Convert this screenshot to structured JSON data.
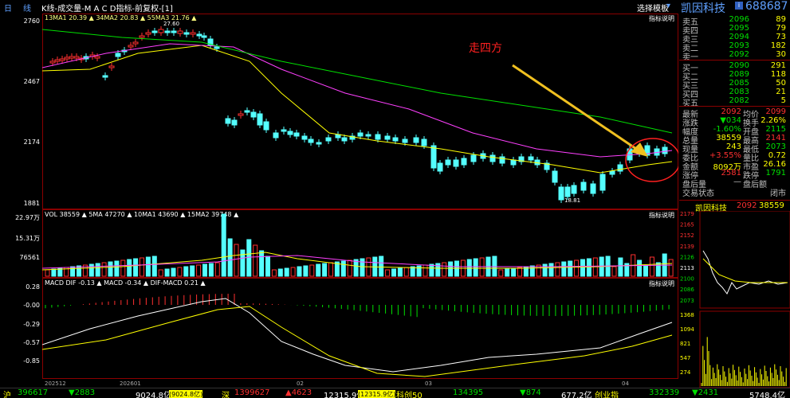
{
  "window": {
    "day_tab": "日",
    "line_tab": "线",
    "chart_title": "K线-成交量-M A C D指标-前复权-[1]",
    "template_button": "选择模板",
    "stock_name": "凯因科技",
    "stock_code": "688687",
    "indicator_help": "指标说明"
  },
  "main_chart": {
    "ma_text": "13MA1 20.39 ▲ 34MA2 20.83 ▲ 55MA3 21.76 ▲",
    "y_labels": [
      "2760",
      "2467",
      "2174",
      "1881"
    ],
    "hi_marker": "27.60",
    "lo_marker": "18.81",
    "annotation": "走四方",
    "annotation_color": "#ff2020"
  },
  "volume_chart": {
    "text": "VOL 38559 ▲ 5MA 47270 ▲ 10MA1 43690 ▲ 15MA2 39748 ▲",
    "y_labels": [
      "22.97万",
      "15.31万",
      "76561"
    ]
  },
  "macd_chart": {
    "text": "MACD DIF -0.13 ▲ MACD -0.34 ▲ DIF-MACD 0.21 ▲",
    "y_labels": [
      "0.28",
      "-0.00",
      "-0.29",
      "-0.57",
      "-0.85"
    ]
  },
  "x_labels": [
    "202512",
    "202601",
    "02",
    "03",
    "04"
  ],
  "order_book": {
    "asks": [
      {
        "label": "卖五",
        "price": "2096",
        "vol": "89"
      },
      {
        "label": "卖四",
        "price": "2095",
        "vol": "79"
      },
      {
        "label": "卖三",
        "price": "2094",
        "vol": "73"
      },
      {
        "label": "卖二",
        "price": "2093",
        "vol": "182"
      },
      {
        "label": "卖一",
        "price": "2092",
        "vol": "30"
      }
    ],
    "bids": [
      {
        "label": "买一",
        "price": "2090",
        "vol": "291"
      },
      {
        "label": "买二",
        "price": "2089",
        "vol": "118"
      },
      {
        "label": "买三",
        "price": "2085",
        "vol": "50"
      },
      {
        "label": "买四",
        "price": "2083",
        "vol": "21"
      },
      {
        "label": "买五",
        "price": "2082",
        "vol": "5"
      }
    ]
  },
  "quote": [
    {
      "k1": "最新",
      "v1": "2092",
      "k2": "均价",
      "v2": "2099",
      "c1": "#ff3030",
      "c2": "#ff3030"
    },
    {
      "k1": "涨跌",
      "v1": "▼034",
      "k2": "换手",
      "v2": "2.26%",
      "c1": "#00e000",
      "c2": "#ffff00"
    },
    {
      "k1": "幅度",
      "v1": "-1.60%",
      "k2": "开盘",
      "v2": "2115",
      "c1": "#00e000",
      "c2": "#00e000"
    },
    {
      "k1": "总量",
      "v1": "38559",
      "k2": "最高",
      "v2": "2141",
      "c1": "#ffff00",
      "c2": "#ff3030"
    },
    {
      "k1": "现量",
      "v1": "243",
      "k2": "最低",
      "v2": "2073",
      "c1": "#ffff00",
      "c2": "#00e000"
    },
    {
      "k1": "委比",
      "v1": "+3.55%",
      "k2": "量比",
      "v2": "0.72",
      "c1": "#ff3030",
      "c2": "#ffff00"
    },
    {
      "k1": "金额",
      "v1": "8092万",
      "k2": "市盈",
      "v2": "26.16",
      "c1": "#ffff00",
      "c2": "#ffff00"
    },
    {
      "k1": "涨停",
      "v1": "2581",
      "k2": "跌停",
      "v2": "1791",
      "c1": "#ff3030",
      "c2": "#00e000"
    },
    {
      "k1": "盘后量",
      "v1": "—",
      "k2": "盘后额",
      "v2": "",
      "c1": "#c0c0c0",
      "c2": "#c0c0c0"
    }
  ],
  "trade_status": {
    "label": "交易状态",
    "value": "闭市"
  },
  "mini_header": {
    "name": "凯因科技",
    "price": "2092",
    "vol": "38559"
  },
  "mini_price_labels": [
    "2179",
    "2165",
    "2152",
    "2139",
    "2126",
    "2113",
    "2100",
    "2086",
    "2073"
  ],
  "mini_vol_labels": [
    "1368",
    "1094",
    "821",
    "547",
    "274"
  ],
  "status_bar": {
    "sh_label": "沪",
    "sh_index": "396617",
    "sh_change": "▼2883",
    "sh_amount": "9024.8亿",
    "sh_amount2": "(9024.8亿)",
    "sz_label": "深",
    "sz_index": "1399627",
    "sz_change": "▲4623",
    "sz_amount": "12315.9亿",
    "sz_amount2": "(12315.9亿)",
    "kc_label": "科创50",
    "kc_index": "134395",
    "kc_change": "▼874",
    "kc_amount": "677.2亿",
    "cy_label": "创业指",
    "cy_index": "332339",
    "cy_change": "▼2431",
    "cy_amount": "5748.4亿"
  },
  "colors": {
    "up": "#ff3030",
    "down": "#54ffff",
    "panel_border": "#8b0000"
  }
}
